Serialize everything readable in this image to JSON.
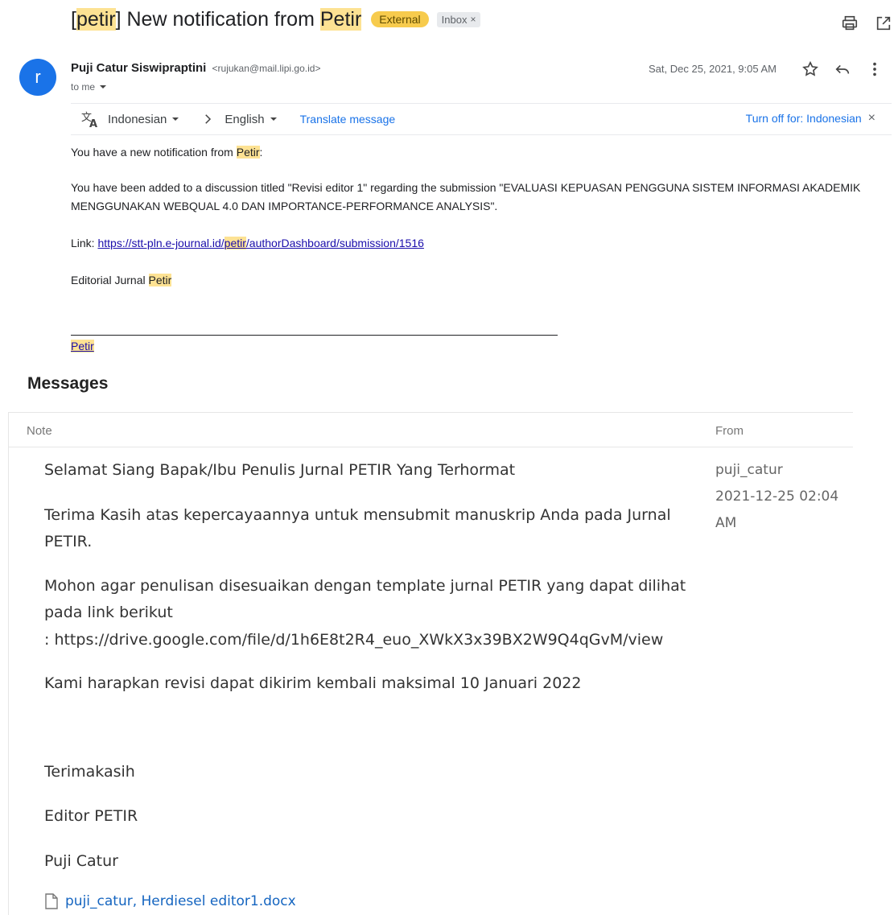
{
  "email": {
    "subject": {
      "prefix_open": "[",
      "prefix_word": "petir",
      "prefix_close": "]",
      "middle": " New notification from ",
      "highlight": "Petir"
    },
    "labels": {
      "external": "External",
      "inbox": "Inbox",
      "inbox_remove": "×"
    },
    "avatar_letter": "r",
    "sender": {
      "name": "Puji Catur Siswipraptini",
      "email": "<rujukan@mail.lipi.go.id>",
      "to": "to me"
    },
    "date": "Sat, Dec 25, 2021, 9:05 AM",
    "translate": {
      "from_lang": "Indonesian",
      "to_lang": "English",
      "translate_link": "Translate message",
      "turn_off": "Turn off for: Indonesian",
      "close": "×"
    },
    "body": {
      "notif_prefix": "You have a new notification from ",
      "notif_highlight": "Petir",
      "notif_suffix": ":",
      "added_text": "You have been added to a discussion titled \"Revisi editor 1\" regarding the submission \"EVALUASI KEPUASAN PENGGUNA SISTEM INFORMASI AKADEMIK MENGGUNAKAN WEBQUAL 4.0 DAN IMPORTANCE-PERFORMANCE ANALYSIS\".",
      "link_label": "Link: ",
      "link_part1": "https://stt-pln.e-journal.id/",
      "link_highlight": "petir",
      "link_part2": "/authorDashboard/submission/1516",
      "signature_prefix": "Editorial Jurnal ",
      "signature_highlight": "Petir",
      "footer_link": "Petir"
    }
  },
  "messages": {
    "title": "Messages",
    "col_note": "Note",
    "col_from": "From",
    "note_lines": [
      "Selamat Siang Bapak/Ibu Penulis Jurnal PETIR Yang Terhormat",
      "Terima Kasih atas kepercayaannya untuk mensubmit manuskrip Anda pada Jurnal PETIR.",
      "Mohon agar penulisan disesuaikan dengan template jurnal PETIR yang dapat dilihat pada link berikut",
      ": https://drive.google.com/file/d/1h6E8t2R4_euo_XWkX3x39BX2W9Q4qGvM/view",
      "Kami harapkan revisi dapat dikirim kembali maksimal 10 Januari 2022",
      "Terimakasih",
      "Editor PETIR",
      "Puji Catur"
    ],
    "from_user": "puji_catur",
    "from_date": "2021-12-25 02:04 AM",
    "attachment": "puji_catur, Herdiesel editor1.docx"
  }
}
